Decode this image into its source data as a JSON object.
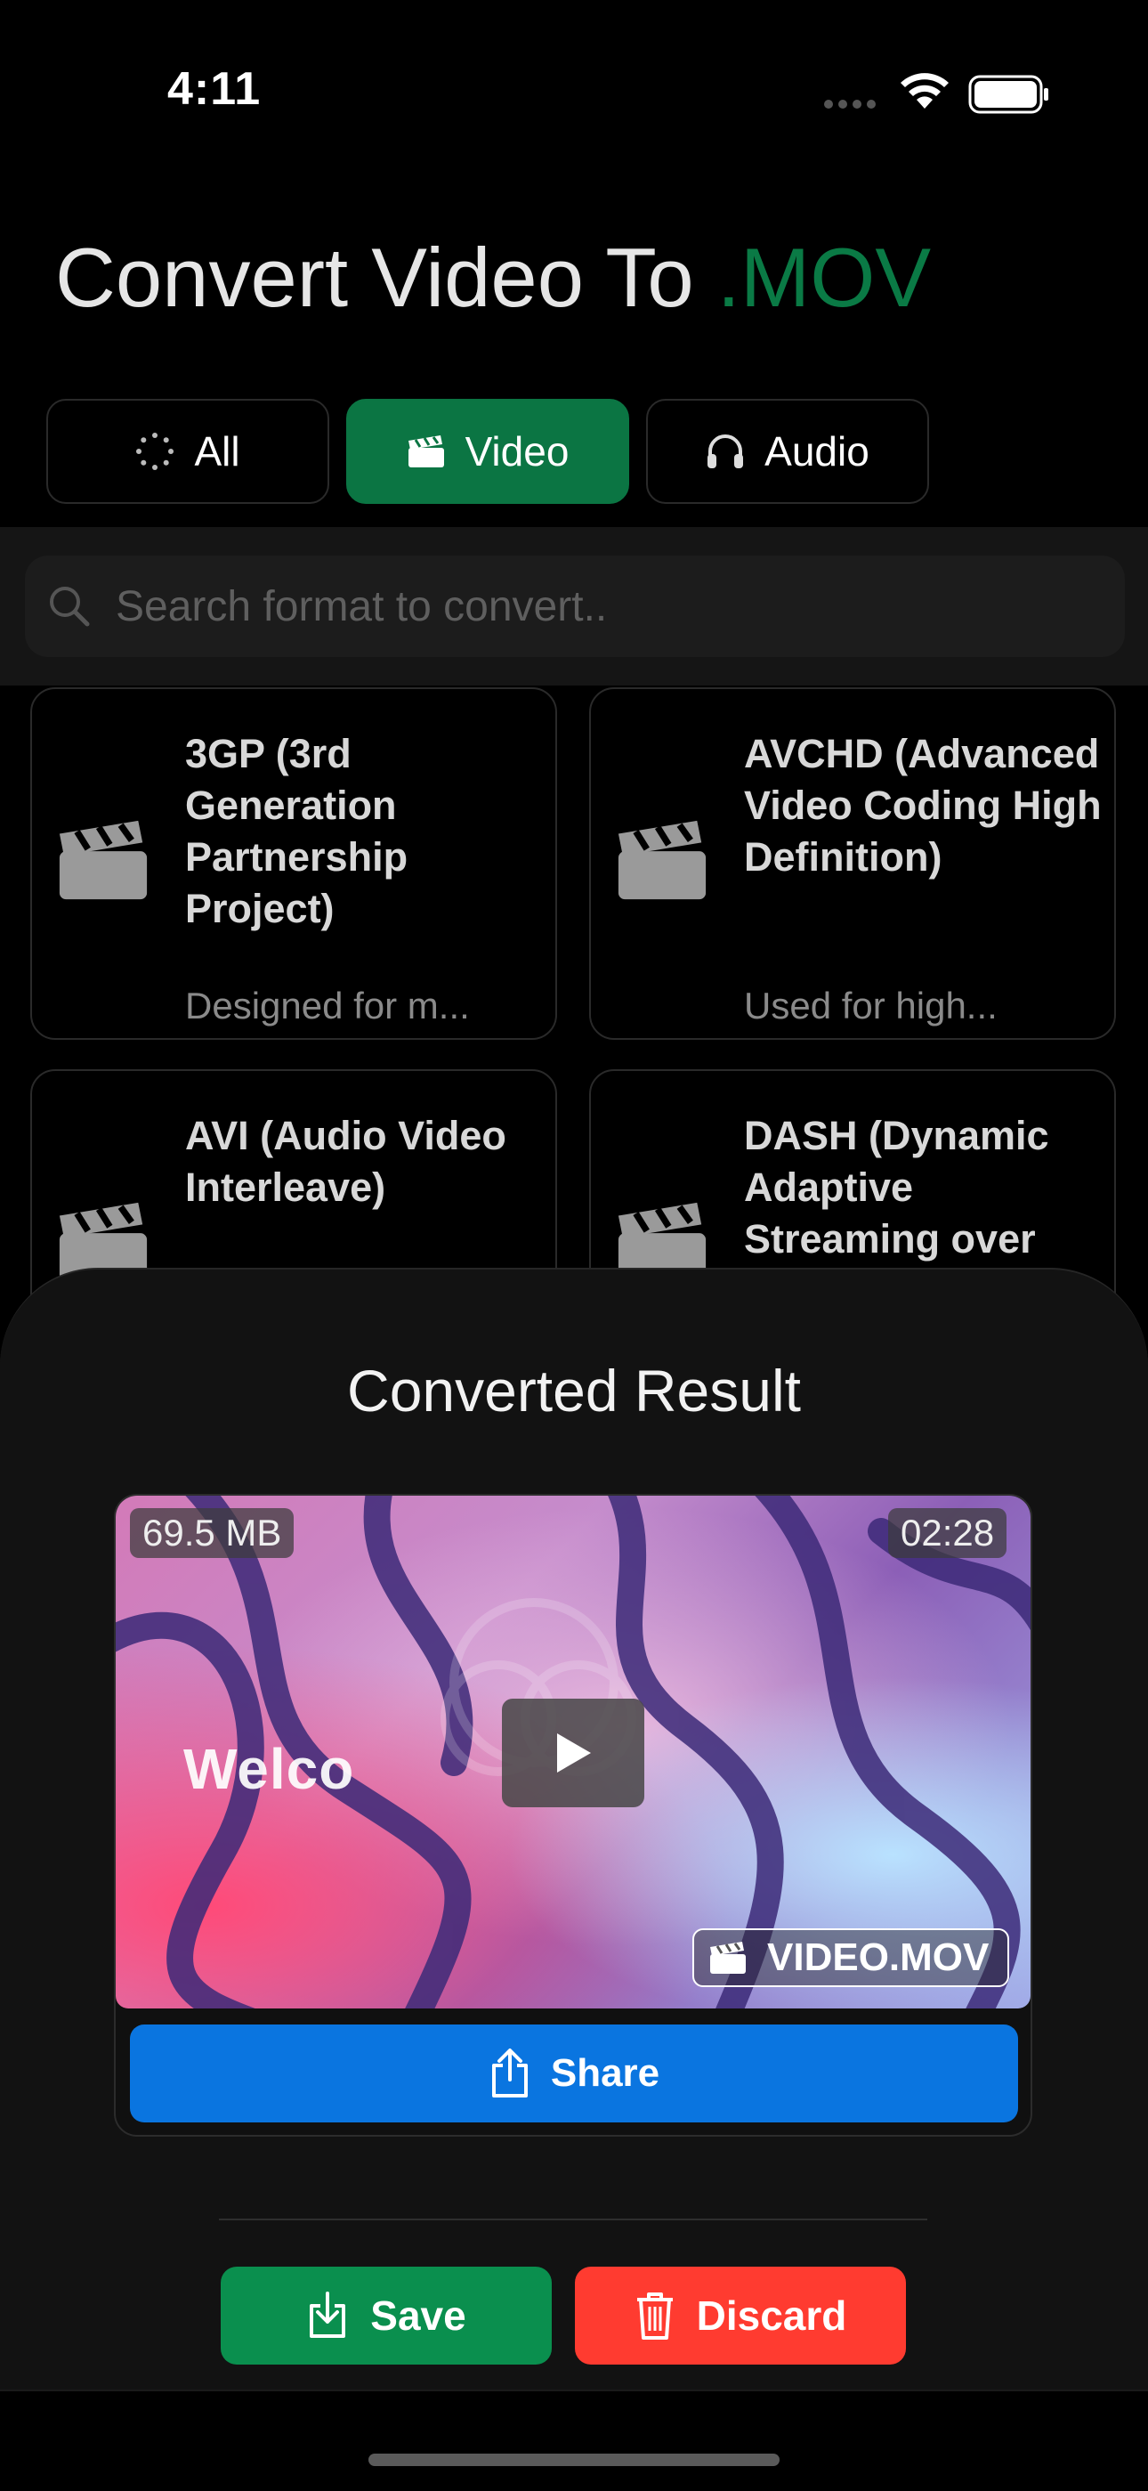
{
  "status_bar": {
    "time": "4:11"
  },
  "header": {
    "title_prefix": "Convert Video To",
    "title_accent": ".MOV"
  },
  "filters": [
    {
      "label": "All",
      "icon": "spinner-icon",
      "active": false
    },
    {
      "label": "Video",
      "icon": "clapperboard-icon",
      "active": true
    },
    {
      "label": "Audio",
      "icon": "headphones-icon",
      "active": false
    }
  ],
  "search": {
    "placeholder": "Search format to convert.."
  },
  "formats": [
    {
      "name": "3GP (3rd Generation Partnership Project)",
      "description": "Designed for m..."
    },
    {
      "name": "AVCHD (Advanced Video Coding High Definition)",
      "description": "Used for high..."
    },
    {
      "name": "AVI (Audio Video Interleave)",
      "description": ""
    },
    {
      "name": "DASH (Dynamic Adaptive Streaming over",
      "description": ""
    }
  ],
  "result": {
    "title": "Converted Result",
    "file_size": "69.5 MB",
    "duration": "02:28",
    "overlay_text": "Welco",
    "file_name": "VIDEO.MOV",
    "share_label": "Share",
    "save_label": "Save",
    "discard_label": "Discard"
  },
  "colors": {
    "accent_green": "#0b7543",
    "share_blue": "#0a75e0",
    "save_green": "#0a8f4e",
    "discard_red": "#ff3b30"
  }
}
